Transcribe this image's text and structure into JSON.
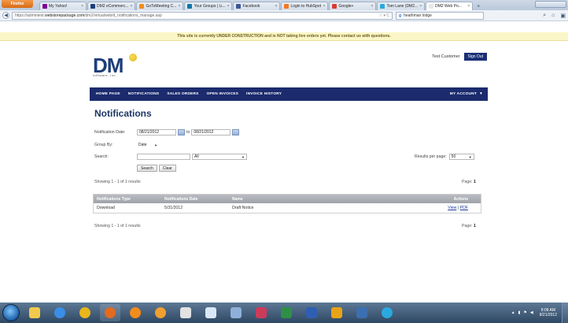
{
  "browser": {
    "app_button": "Firefox",
    "tabs": [
      {
        "label": "My Yahoo!",
        "color": "#7b0099"
      },
      {
        "label": "DM2 eCommerc...",
        "color": "#1d3d7a"
      },
      {
        "label": "GoToMeeting C...",
        "color": "#f28c1c"
      },
      {
        "label": "Your Groups | Li...",
        "color": "#0e76a8"
      },
      {
        "label": "Facebook",
        "color": "#3b5998"
      },
      {
        "label": "Login to HubSpot",
        "color": "#f57722"
      },
      {
        "label": "Google+",
        "color": "#d73d32"
      },
      {
        "label": "Tom Lane (DM2...",
        "color": "#2aa9e0"
      },
      {
        "label": "DM2 Web Po...",
        "color": "#e8e8e8",
        "active": true
      }
    ],
    "url_prefix": "https://admintest.",
    "url_host": "webstorepackage.com",
    "url_rest": "/dm2/virtualweb/d_notifications_manage.asp",
    "search_engine": "g",
    "search_value": "heathman lodge"
  },
  "banner": "This site is currently UNDER CONSTRUCTION and is NOT taking live orders yet. Please contact us with questions.",
  "header": {
    "logo_text": "DM",
    "logo_sub": "software, inc.",
    "user_name": "Test Customer",
    "signout_label": "Sign Out"
  },
  "menu": {
    "items": [
      "HOME PAGE",
      "NOTIFICATIONS",
      "SALES ORDERS",
      "OPEN INVOICES",
      "INVOICE HISTORY"
    ],
    "account": "MY ACCOUNT"
  },
  "page": {
    "title": "Notifications",
    "date_label": "Notification Date:",
    "date_from": "08/21/2012",
    "to_label": "to",
    "date_to": "08/21/2012",
    "group_label": "Group By:",
    "group_value": "Date",
    "search_label": "Search:",
    "search_value": "",
    "search_scope": "All",
    "search_button": "Search",
    "clear_button": "Clear",
    "rpp_label": "Results per page:",
    "rpp_value": "50",
    "showing_top": "Showing 1 - 1 of 1 results",
    "showing_bottom": "Showing 1 - 1 of 1 results",
    "page_label": "Page:",
    "page_value": "1"
  },
  "table": {
    "headers": [
      "Notifications Type",
      "Notifications Date",
      "Name",
      "Actions"
    ],
    "rows": [
      {
        "type": "Download",
        "date": "5/31/2012",
        "name": "Draft Notice",
        "view": "View",
        "sep": "|",
        "pdf": "PDF"
      }
    ]
  },
  "taskbar": {
    "time": "8:08 AM",
    "date": "8/21/2012",
    "apps": [
      {
        "name": "explorer",
        "color": "#f2c94c"
      },
      {
        "name": "internet-explorer",
        "color": "#3a8ee6"
      },
      {
        "name": "chrome",
        "color": "#e8b61c"
      },
      {
        "name": "firefox",
        "color": "#e36b1d"
      },
      {
        "name": "gotomeeting",
        "color": "#f28c1c"
      },
      {
        "name": "media-player",
        "color": "#f0a030"
      },
      {
        "name": "paint",
        "color": "#e2e2e2"
      },
      {
        "name": "notepad",
        "color": "#d9e8f7"
      },
      {
        "name": "app",
        "color": "#8fb0d8"
      },
      {
        "name": "photoshop",
        "color": "#cc3b5a"
      },
      {
        "name": "excel",
        "color": "#2f8f46"
      },
      {
        "name": "word",
        "color": "#2f5fb3"
      },
      {
        "name": "outlook",
        "color": "#e8a317"
      },
      {
        "name": "app2",
        "color": "#3c6fb0"
      },
      {
        "name": "skype",
        "color": "#2aa9e0"
      }
    ]
  }
}
